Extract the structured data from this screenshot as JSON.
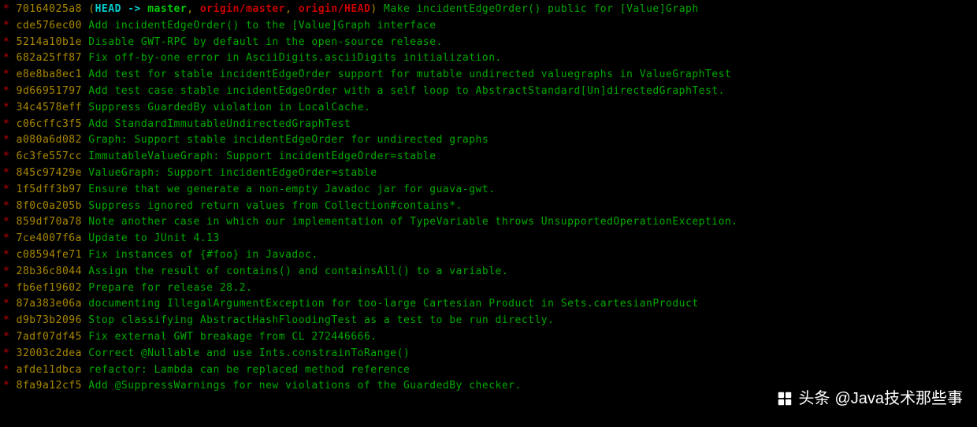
{
  "commits": [
    {
      "hash": "70164025a8",
      "refs": {
        "head": "HEAD",
        "arrow": " -> ",
        "local": "master",
        "sep1": ", ",
        "remote1": "origin/master",
        "sep2": ", ",
        "remote2": "origin/HEAD"
      },
      "message": "Make incidentEdgeOrder() public for [Value]Graph"
    },
    {
      "hash": "cde576ec00",
      "message": "Add incidentEdgeOrder() to the [Value]Graph interface"
    },
    {
      "hash": "5214a10b1e",
      "message": "Disable GWT-RPC by default in the open-source release."
    },
    {
      "hash": "682a25ff87",
      "message": "Fix off-by-one error in AsciiDigits.asciiDigits initialization."
    },
    {
      "hash": "e8e8ba8ec1",
      "message": "Add test for stable incidentEdgeOrder support for mutable undirected valuegraphs in ValueGraphTest"
    },
    {
      "hash": "9d66951797",
      "message": "Add test case stable incidentEdgeOrder with a self loop to AbstractStandard[Un]directedGraphTest."
    },
    {
      "hash": "34c4578eff",
      "message": "Suppress GuardedBy violation in LocalCache."
    },
    {
      "hash": "c06cffc3f5",
      "message": "Add StandardImmutableUndirectedGraphTest"
    },
    {
      "hash": "a080a6d082",
      "message": "Graph: Support stable incidentEdgeOrder for undirected graphs"
    },
    {
      "hash": "6c3fe557cc",
      "message": "ImmutableValueGraph: Support incidentEdgeOrder=stable"
    },
    {
      "hash": "845c97429e",
      "message": "ValueGraph: Support incidentEdgeOrder=stable"
    },
    {
      "hash": "1f5dff3b97",
      "message": "Ensure that we generate a non-empty Javadoc jar for guava-gwt."
    },
    {
      "hash": "8f0c0a205b",
      "message": "Suppress ignored return values from Collection#contains*."
    },
    {
      "hash": "859df70a78",
      "message": "Note another case in which our implementation of TypeVariable throws UnsupportedOperationException."
    },
    {
      "hash": "7ce4007f6a",
      "message": "Update to JUnit 4.13"
    },
    {
      "hash": "c08594fe71",
      "message": "Fix instances of {#foo} in Javadoc."
    },
    {
      "hash": "28b36c8044",
      "message": "Assign the result of contains() and containsAll() to a variable."
    },
    {
      "hash": "fb6ef19602",
      "message": "Prepare for release 28.2."
    },
    {
      "hash": "87a383e06a",
      "message": "documenting IllegalArgumentException for too-large Cartesian Product in Sets.cartesianProduct"
    },
    {
      "hash": "d9b73b2096",
      "message": "Stop classifying AbstractHashFloodingTest as a test to be run directly."
    },
    {
      "hash": "7adf07df45",
      "message": "Fix external GWT breakage from CL 272446666."
    },
    {
      "hash": "32003c2dea",
      "message": "Correct @Nullable and use Ints.constrainToRange()"
    },
    {
      "hash": "afde11dbca",
      "message": "refactor: Lambda can be replaced method reference"
    },
    {
      "hash": "8fa9a12cf5",
      "message": "Add @SuppressWarnings for new violations of the GuardedBy checker."
    }
  ],
  "star": "*",
  "paren_open": "(",
  "paren_close": ")",
  "watermark": {
    "prefix": "头条",
    "handle": "@Java技术那些事"
  }
}
